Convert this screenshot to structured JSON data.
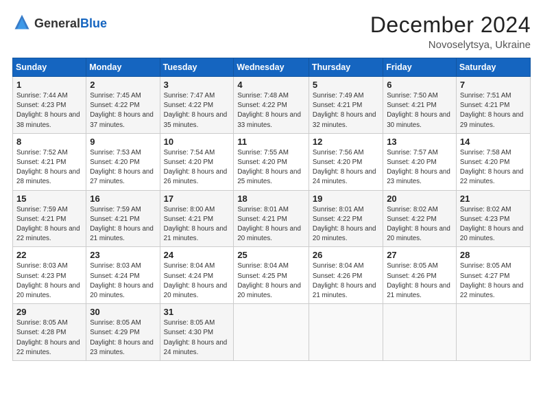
{
  "header": {
    "logo_general": "General",
    "logo_blue": "Blue",
    "month_title": "December 2024",
    "location": "Novoselytsya, Ukraine"
  },
  "days_of_week": [
    "Sunday",
    "Monday",
    "Tuesday",
    "Wednesday",
    "Thursday",
    "Friday",
    "Saturday"
  ],
  "weeks": [
    [
      {
        "day": "1",
        "sunrise": "Sunrise: 7:44 AM",
        "sunset": "Sunset: 4:23 PM",
        "daylight": "Daylight: 8 hours and 38 minutes."
      },
      {
        "day": "2",
        "sunrise": "Sunrise: 7:45 AM",
        "sunset": "Sunset: 4:22 PM",
        "daylight": "Daylight: 8 hours and 37 minutes."
      },
      {
        "day": "3",
        "sunrise": "Sunrise: 7:47 AM",
        "sunset": "Sunset: 4:22 PM",
        "daylight": "Daylight: 8 hours and 35 minutes."
      },
      {
        "day": "4",
        "sunrise": "Sunrise: 7:48 AM",
        "sunset": "Sunset: 4:22 PM",
        "daylight": "Daylight: 8 hours and 33 minutes."
      },
      {
        "day": "5",
        "sunrise": "Sunrise: 7:49 AM",
        "sunset": "Sunset: 4:21 PM",
        "daylight": "Daylight: 8 hours and 32 minutes."
      },
      {
        "day": "6",
        "sunrise": "Sunrise: 7:50 AM",
        "sunset": "Sunset: 4:21 PM",
        "daylight": "Daylight: 8 hours and 30 minutes."
      },
      {
        "day": "7",
        "sunrise": "Sunrise: 7:51 AM",
        "sunset": "Sunset: 4:21 PM",
        "daylight": "Daylight: 8 hours and 29 minutes."
      }
    ],
    [
      {
        "day": "8",
        "sunrise": "Sunrise: 7:52 AM",
        "sunset": "Sunset: 4:21 PM",
        "daylight": "Daylight: 8 hours and 28 minutes."
      },
      {
        "day": "9",
        "sunrise": "Sunrise: 7:53 AM",
        "sunset": "Sunset: 4:20 PM",
        "daylight": "Daylight: 8 hours and 27 minutes."
      },
      {
        "day": "10",
        "sunrise": "Sunrise: 7:54 AM",
        "sunset": "Sunset: 4:20 PM",
        "daylight": "Daylight: 8 hours and 26 minutes."
      },
      {
        "day": "11",
        "sunrise": "Sunrise: 7:55 AM",
        "sunset": "Sunset: 4:20 PM",
        "daylight": "Daylight: 8 hours and 25 minutes."
      },
      {
        "day": "12",
        "sunrise": "Sunrise: 7:56 AM",
        "sunset": "Sunset: 4:20 PM",
        "daylight": "Daylight: 8 hours and 24 minutes."
      },
      {
        "day": "13",
        "sunrise": "Sunrise: 7:57 AM",
        "sunset": "Sunset: 4:20 PM",
        "daylight": "Daylight: 8 hours and 23 minutes."
      },
      {
        "day": "14",
        "sunrise": "Sunrise: 7:58 AM",
        "sunset": "Sunset: 4:20 PM",
        "daylight": "Daylight: 8 hours and 22 minutes."
      }
    ],
    [
      {
        "day": "15",
        "sunrise": "Sunrise: 7:59 AM",
        "sunset": "Sunset: 4:21 PM",
        "daylight": "Daylight: 8 hours and 22 minutes."
      },
      {
        "day": "16",
        "sunrise": "Sunrise: 7:59 AM",
        "sunset": "Sunset: 4:21 PM",
        "daylight": "Daylight: 8 hours and 21 minutes."
      },
      {
        "day": "17",
        "sunrise": "Sunrise: 8:00 AM",
        "sunset": "Sunset: 4:21 PM",
        "daylight": "Daylight: 8 hours and 21 minutes."
      },
      {
        "day": "18",
        "sunrise": "Sunrise: 8:01 AM",
        "sunset": "Sunset: 4:21 PM",
        "daylight": "Daylight: 8 hours and 20 minutes."
      },
      {
        "day": "19",
        "sunrise": "Sunrise: 8:01 AM",
        "sunset": "Sunset: 4:22 PM",
        "daylight": "Daylight: 8 hours and 20 minutes."
      },
      {
        "day": "20",
        "sunrise": "Sunrise: 8:02 AM",
        "sunset": "Sunset: 4:22 PM",
        "daylight": "Daylight: 8 hours and 20 minutes."
      },
      {
        "day": "21",
        "sunrise": "Sunrise: 8:02 AM",
        "sunset": "Sunset: 4:23 PM",
        "daylight": "Daylight: 8 hours and 20 minutes."
      }
    ],
    [
      {
        "day": "22",
        "sunrise": "Sunrise: 8:03 AM",
        "sunset": "Sunset: 4:23 PM",
        "daylight": "Daylight: 8 hours and 20 minutes."
      },
      {
        "day": "23",
        "sunrise": "Sunrise: 8:03 AM",
        "sunset": "Sunset: 4:24 PM",
        "daylight": "Daylight: 8 hours and 20 minutes."
      },
      {
        "day": "24",
        "sunrise": "Sunrise: 8:04 AM",
        "sunset": "Sunset: 4:24 PM",
        "daylight": "Daylight: 8 hours and 20 minutes."
      },
      {
        "day": "25",
        "sunrise": "Sunrise: 8:04 AM",
        "sunset": "Sunset: 4:25 PM",
        "daylight": "Daylight: 8 hours and 20 minutes."
      },
      {
        "day": "26",
        "sunrise": "Sunrise: 8:04 AM",
        "sunset": "Sunset: 4:26 PM",
        "daylight": "Daylight: 8 hours and 21 minutes."
      },
      {
        "day": "27",
        "sunrise": "Sunrise: 8:05 AM",
        "sunset": "Sunset: 4:26 PM",
        "daylight": "Daylight: 8 hours and 21 minutes."
      },
      {
        "day": "28",
        "sunrise": "Sunrise: 8:05 AM",
        "sunset": "Sunset: 4:27 PM",
        "daylight": "Daylight: 8 hours and 22 minutes."
      }
    ],
    [
      {
        "day": "29",
        "sunrise": "Sunrise: 8:05 AM",
        "sunset": "Sunset: 4:28 PM",
        "daylight": "Daylight: 8 hours and 22 minutes."
      },
      {
        "day": "30",
        "sunrise": "Sunrise: 8:05 AM",
        "sunset": "Sunset: 4:29 PM",
        "daylight": "Daylight: 8 hours and 23 minutes."
      },
      {
        "day": "31",
        "sunrise": "Sunrise: 8:05 AM",
        "sunset": "Sunset: 4:30 PM",
        "daylight": "Daylight: 8 hours and 24 minutes."
      },
      null,
      null,
      null,
      null
    ]
  ]
}
